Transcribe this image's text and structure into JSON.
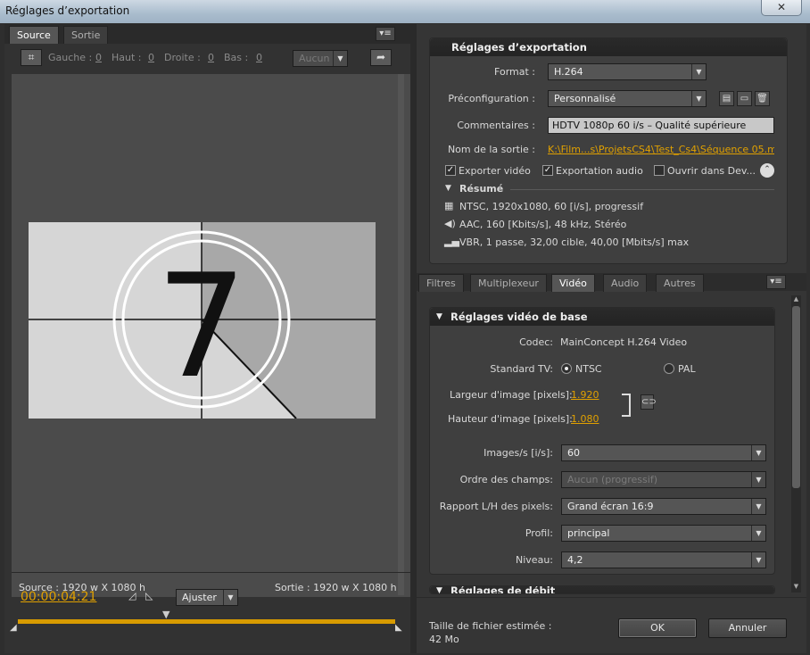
{
  "window": {
    "title": "Réglages d’exportation",
    "close_glyph": "✕"
  },
  "left": {
    "tabs": [
      "Source",
      "Sortie"
    ],
    "crop": {
      "gauche_label": "Gauche :",
      "gauche_val": "0",
      "haut_label": "Haut :",
      "haut_val": "0",
      "droite_label": "Droite :",
      "droite_val": "0",
      "bas_label": "Bas :",
      "bas_val": "0",
      "aspect": "Aucun"
    },
    "countdown_number": "7",
    "source_info": "Source : 1920 w X 1080 h",
    "output_info": "Sortie : 1920 w X 1080 h",
    "timecode": "00:00:04:21",
    "fit": "Ajuster",
    "timeline_progress": 1.0
  },
  "export": {
    "title": "Réglages d’exportation",
    "format_label": "Format :",
    "format": "H.264",
    "preset_label": "Préconfiguration :",
    "preset": "Personnalisé",
    "comments_label": "Commentaires :",
    "comments": "HDTV 1080p 60 i/s – Qualité supérieure",
    "output_label": "Nom de la sortie :",
    "output_name": "K:\\Film...s\\ProjetsCS4\\Test_Cs4\\Séquence 05.mp4",
    "export_video": "Exporter vidéo",
    "export_audio": "Exportation audio",
    "open_in": "Ouvrir dans Dev...",
    "summary_title": "Résumé",
    "summary": [
      "NTSC, 1920x1080, 60 [i/s], progressif",
      "AAC, 160 [Kbits/s], 48 kHz, Stéréo",
      "VBR, 1 passe, 32,00 cible, 40,00 [Mbits/s] max"
    ]
  },
  "tabs2": [
    "Filtres",
    "Multiplexeur",
    "Vidéo",
    "Audio",
    "Autres"
  ],
  "video": {
    "section_title": "Réglages vidéo de base",
    "codec_label": "Codec:",
    "codec": "MainConcept H.264 Video",
    "tv_label": "Standard TV:",
    "ntsc": "NTSC",
    "pal": "PAL",
    "width_label": "Largeur d'image [pixels]:",
    "width": "1.920",
    "height_label": "Hauteur d'image [pixels]:",
    "height": "1.080",
    "fps_label": "Images/s [i/s]:",
    "fps": "60",
    "field_label": "Ordre des champs:",
    "field": "Aucun (progressif)",
    "par_label": "Rapport L/H des pixels:",
    "par": "Grand écran 16:9",
    "profile_label": "Profil:",
    "profile": "principal",
    "level_label": "Niveau:",
    "level": "4,2",
    "bitrate_title": "Réglages de débit"
  },
  "footer": {
    "size_label": "Taille de fichier estimée :",
    "size": "42 Mo",
    "ok": "OK",
    "cancel": "Annuler"
  },
  "colors": {
    "accent": "#e0a000",
    "timeline": "#d89b00"
  }
}
